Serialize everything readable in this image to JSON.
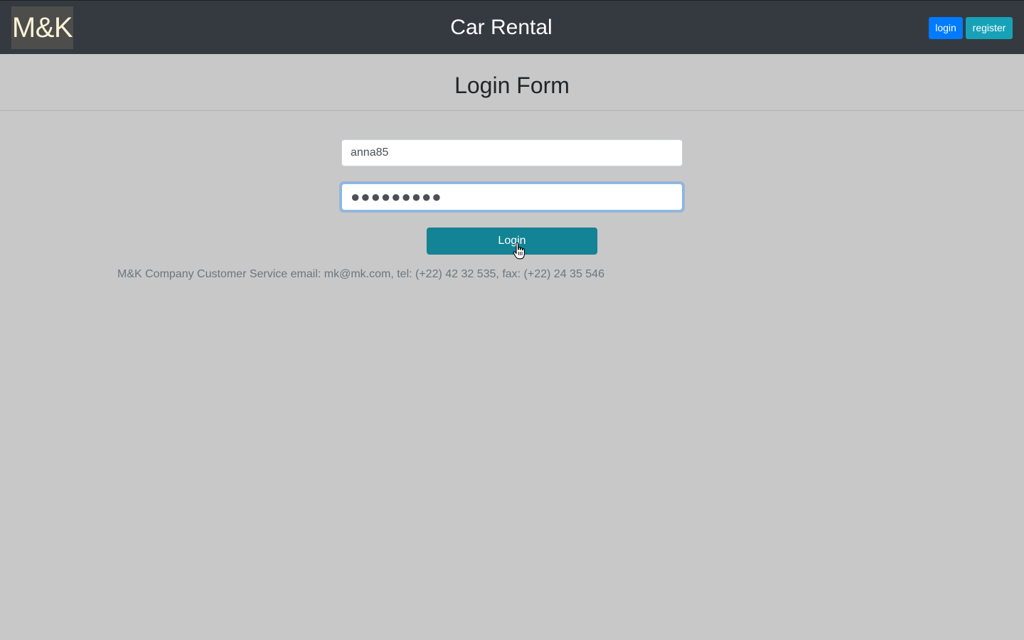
{
  "navbar": {
    "logo_text": "M&K",
    "title": "Car Rental",
    "login_label": "login",
    "register_label": "register",
    "colors": {
      "background": "#343a40",
      "login_button": "#007bff",
      "register_button": "#17a2b8"
    }
  },
  "form": {
    "title": "Login Form",
    "username_value": "anna85",
    "password_value": "●●●●●●●●●",
    "submit_label": "Login",
    "submit_color": "#138496"
  },
  "footer": {
    "text": "M&K Company Customer Service email: mk@mk.com, tel: (+22) 42 32 535, fax: (+22) 24 35 546"
  },
  "page": {
    "background": "#c8c8c8"
  },
  "icons": {
    "cursor": "hand-pointer-icon"
  }
}
